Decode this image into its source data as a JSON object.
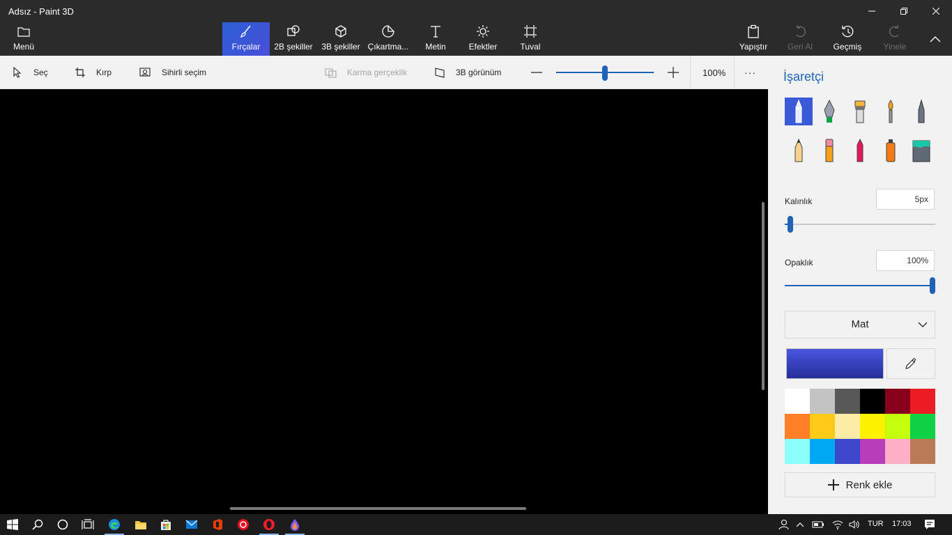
{
  "window": {
    "title": "Adsız - Paint 3D"
  },
  "ribbon": {
    "menu": "Menü",
    "tabs": [
      {
        "label": "Fırçalar"
      },
      {
        "label": "2B şekiller"
      },
      {
        "label": "3B şekiller"
      },
      {
        "label": "Çıkartma..."
      },
      {
        "label": "Metin"
      },
      {
        "label": "Efektler"
      },
      {
        "label": "Tuval"
      }
    ],
    "paste": "Yapıştır",
    "undo": "Geri Al",
    "history": "Geçmiş",
    "redo": "Yinele"
  },
  "toolbar": {
    "select": "Seç",
    "crop": "Kırp",
    "magic_select": "Sihirli seçim",
    "mixed_reality": "Karma gerçeklik",
    "view_3d": "3B görünüm",
    "zoom_value": "100%",
    "zoom_level": 0.5,
    "more": "···"
  },
  "panel": {
    "title": "İşaretçi",
    "brushes": [
      "marker-icon",
      "calligraphy-pen-icon",
      "oil-brush-icon",
      "watercolor-icon",
      "pixel-pen-icon",
      "pencil-icon",
      "eraser-icon",
      "crayon-icon",
      "spray-can-icon",
      "fill-bucket-icon"
    ],
    "thickness_label": "Kalınlık",
    "thickness_value": "5px",
    "thickness_level": 0.02,
    "opacity_label": "Opaklık",
    "opacity_value": "100%",
    "opacity_level": 1.0,
    "finish": "Mat",
    "current_color": "#3a44c8",
    "palette": [
      "#ffffff",
      "#c3c3c3",
      "#585858",
      "#000000",
      "#88001b",
      "#ec1c24",
      "#ff7f27",
      "#ffca18",
      "#fdeca6",
      "#fff200",
      "#c4ff0e",
      "#0ed145",
      "#8cfffb",
      "#00a8f3",
      "#3f48cc",
      "#b83dba",
      "#ffaec8",
      "#b97a56"
    ],
    "add_color": "Renk ekle"
  },
  "taskbar": {
    "language": "TUR",
    "time": "17:03"
  }
}
